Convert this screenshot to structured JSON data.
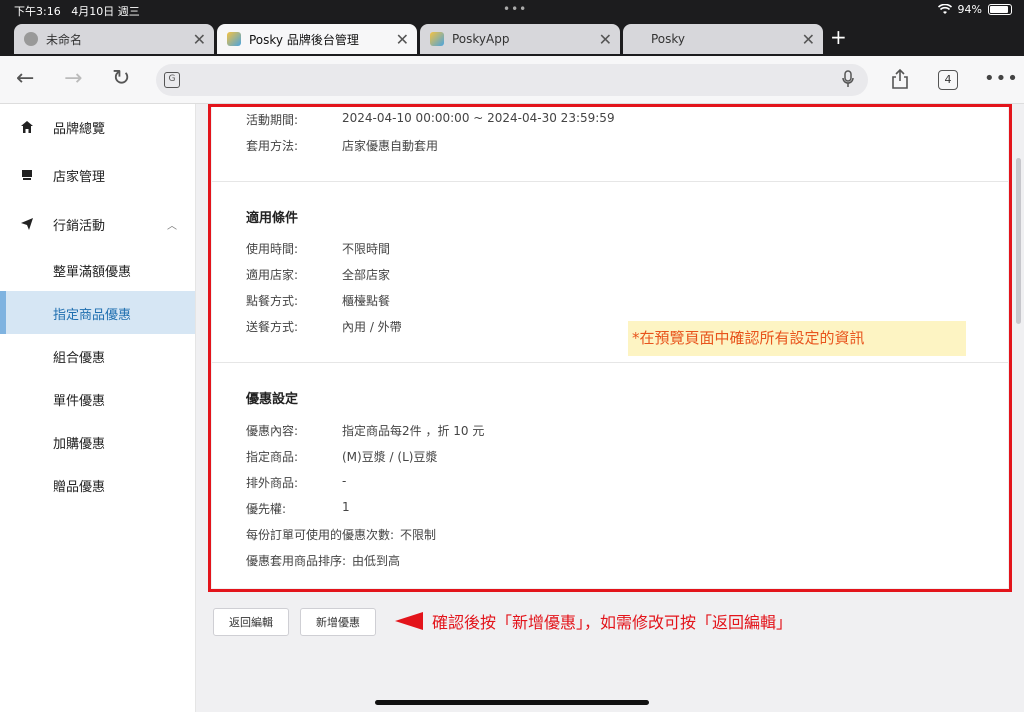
{
  "status_bar": {
    "time": "下午3:16",
    "date": "4月10日 週三",
    "battery": "94%"
  },
  "tabs": [
    {
      "title": "未命名",
      "active": false
    },
    {
      "title": "Posky 品牌後台管理",
      "active": true
    },
    {
      "title": "PoskyApp",
      "active": false
    },
    {
      "title": "Posky",
      "active": false
    }
  ],
  "toolbar": {
    "tab_count": "4"
  },
  "sidebar": {
    "items": [
      {
        "label": "品牌總覽",
        "icon": "home-icon"
      },
      {
        "label": "店家管理",
        "icon": "store-icon"
      },
      {
        "label": "行銷活動",
        "icon": "send-icon"
      }
    ],
    "sub_items": [
      {
        "label": "整單滿額優惠",
        "active": false
      },
      {
        "label": "指定商品優惠",
        "active": true
      },
      {
        "label": "組合優惠",
        "active": false
      },
      {
        "label": "單件優惠",
        "active": false
      },
      {
        "label": "加購優惠",
        "active": false
      },
      {
        "label": "贈品優惠",
        "active": false
      }
    ]
  },
  "preview": {
    "basic": [
      {
        "key": "活動期間:",
        "value": "2024-04-10 00:00:00 ~ 2024-04-30 23:59:59"
      },
      {
        "key": "套用方法:",
        "value": "店家優惠自動套用"
      }
    ],
    "conditions_title": "適用條件",
    "conditions": [
      {
        "key": "使用時間:",
        "value": "不限時間"
      },
      {
        "key": "適用店家:",
        "value": "全部店家"
      },
      {
        "key": "點餐方式:",
        "value": "櫃檯點餐"
      },
      {
        "key": "送餐方式:",
        "value": "內用 / 外帶"
      }
    ],
    "discount_title": "優惠設定",
    "discount": [
      {
        "key": "優惠內容:",
        "value": "指定商品每2件 ，折 10 元"
      },
      {
        "key": "指定商品:",
        "value": "(M)豆漿 / (L)豆漿"
      },
      {
        "key": "排外商品:",
        "value": "-"
      },
      {
        "key": "優先權:",
        "value": "1"
      },
      {
        "key": "每份訂單可使用的優惠次數:",
        "value": "不限制"
      },
      {
        "key": "優惠套用商品排序:",
        "value": "由低到高"
      }
    ]
  },
  "buttons": {
    "back_edit": "返回編輯",
    "add_discount": "新增優惠"
  },
  "annotations": {
    "preview_note": "*在預覽頁面中確認所有設定的資訊",
    "action_note": "確認後按「新增優惠」，如需修改可按「返回編輯」"
  },
  "colors": {
    "highlight_red": "#e3141b",
    "note_orange": "#e8541c",
    "note_bg": "#fdf4c3",
    "active_bg": "#d6e6f4",
    "active_text": "#1f6fb0"
  }
}
